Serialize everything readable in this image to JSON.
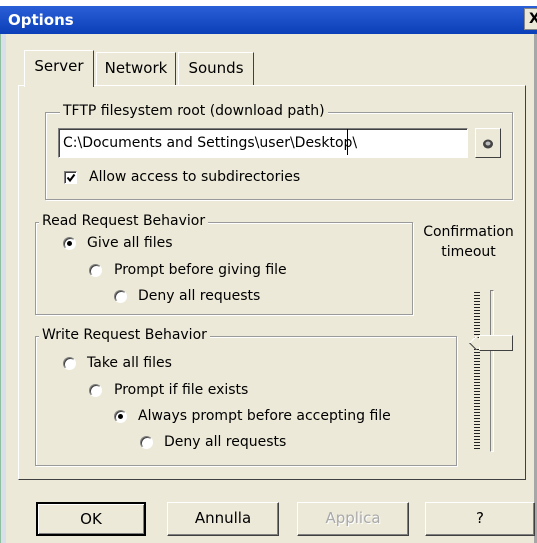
{
  "window": {
    "title": "Options",
    "close_glyph": "X",
    "top_fragment": ""
  },
  "tabs": [
    {
      "label": "Server",
      "active": true
    },
    {
      "label": "Network",
      "active": false
    },
    {
      "label": "Sounds",
      "active": false
    }
  ],
  "tftp_group": {
    "legend": "TFTP filesystem root (download path)",
    "path_value": "C:\\Documents and Settings\\user\\Desktop\\",
    "browse_icon": "folder-browse-icon",
    "allow_subdirs": {
      "label": "Allow access to subdirectories",
      "checked": true
    }
  },
  "read_group": {
    "legend": "Read Request Behavior",
    "options": [
      {
        "label": "Give all files",
        "checked": true
      },
      {
        "label": "Prompt before giving file",
        "checked": false
      },
      {
        "label": "Deny all requests",
        "checked": false
      }
    ]
  },
  "write_group": {
    "legend": "Write Request Behavior",
    "options": [
      {
        "label": "Take all files",
        "checked": false
      },
      {
        "label": "Prompt if file exists",
        "checked": false
      },
      {
        "label": "Always prompt before accepting file",
        "checked": true
      },
      {
        "label": "Deny all requests",
        "checked": false
      }
    ]
  },
  "confirmation": {
    "label_line1": "Confirmation",
    "label_line2": "timeout",
    "slider_level": 0.3
  },
  "buttons": {
    "ok": "OK",
    "cancel": "Annulla",
    "apply": "Applica",
    "help": "?"
  },
  "colors": {
    "dialog_bg": "#ece9d8",
    "titlebar": "#0a3fb8",
    "disabled_text": "#a9a9a9"
  }
}
